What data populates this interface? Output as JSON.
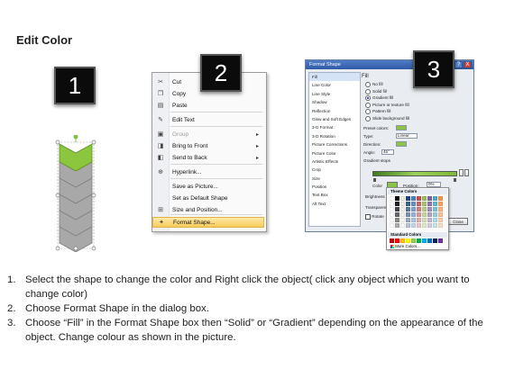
{
  "page": {
    "title": "Edit Color"
  },
  "badges": [
    "1",
    "2",
    "3"
  ],
  "panel1": {
    "fill_color": "#8cc63f",
    "chevron_color": "#a8a8a8",
    "chevron_count": 6
  },
  "menu": {
    "items": [
      {
        "icon": "scissors-icon",
        "label": "Cut",
        "enabled": true
      },
      {
        "icon": "copy-icon",
        "label": "Copy",
        "enabled": true
      },
      {
        "icon": "paste-icon",
        "label": "Paste",
        "enabled": true
      },
      {
        "icon": "edit-text-icon",
        "label": "Edit Text",
        "enabled": true
      },
      {
        "icon": "group-icon",
        "label": "Group",
        "enabled": false,
        "submenu": true
      },
      {
        "icon": "bring-front-icon",
        "label": "Bring to Front",
        "enabled": true,
        "submenu": true
      },
      {
        "icon": "send-back-icon",
        "label": "Send to Back",
        "enabled": true,
        "submenu": true
      },
      {
        "icon": "hyperlink-icon",
        "label": "Hyperlink...",
        "enabled": true
      },
      {
        "icon": "",
        "label": "Save as Picture...",
        "enabled": true
      },
      {
        "icon": "",
        "label": "Set as Default Shape",
        "enabled": true
      },
      {
        "icon": "size-icon",
        "label": "Size and Position...",
        "enabled": true
      },
      {
        "icon": "format-shape-icon",
        "label": "Format Shape...",
        "enabled": true,
        "highlighted": true
      }
    ]
  },
  "dialog": {
    "title": "Format Shape",
    "help": "?",
    "close": "X",
    "categories": [
      "Fill",
      "Line Color",
      "Line Style",
      "Shadow",
      "Reflection",
      "Glow and Soft Edges",
      "3-D Format",
      "3-D Rotation",
      "Picture Corrections",
      "Picture Color",
      "Artistic Effects",
      "Crop",
      "Size",
      "Position",
      "Text Box",
      "Alt Text"
    ],
    "fill_heading": "Fill",
    "fill_options": [
      "No fill",
      "Solid fill",
      "Gradient fill",
      "Picture or texture fill",
      "Pattern fill",
      "Slide background fill"
    ],
    "selected_fill": 2,
    "preset_label": "Preset colors:",
    "type_label": "Type:",
    "type_value": "Linear",
    "direction_label": "Direction:",
    "angle_label": "Angle:",
    "angle_value": "45°",
    "stops_label": "Gradient stops",
    "color_label": "Color",
    "position_label": "Position:",
    "position_value": "0%",
    "brightness_label": "Brightness",
    "transparency_label": "Transparen",
    "rotate_label": "Rotate",
    "close_button": "Close"
  },
  "picker": {
    "theme_label": "Theme Colors",
    "standard_label": "Standard Colors",
    "more_label": "More Colors...",
    "theme_colors": [
      "#ffffff",
      "#000000",
      "#eeece1",
      "#1f497d",
      "#4f81bd",
      "#c0504d",
      "#9bbb59",
      "#8064a2",
      "#4bacc6",
      "#f79646"
    ],
    "standard_colors": [
      "#c00000",
      "#ff0000",
      "#ffc000",
      "#ffff00",
      "#92d050",
      "#00b050",
      "#00b0f0",
      "#0070c0",
      "#002060",
      "#7030a0"
    ]
  },
  "instructions": [
    {
      "num": "1.",
      "text": "Select the shape to change the color and Right click the object( click any object which you want to change color)"
    },
    {
      "num": "2.",
      "text": "Choose Format Shape in the dialog box."
    },
    {
      "num": "3.",
      "text": "Choose “Fill” in the Format Shape box then “Solid” or “Gradient” depending on the appearance of the object. Change colour as shown in the picture."
    }
  ]
}
